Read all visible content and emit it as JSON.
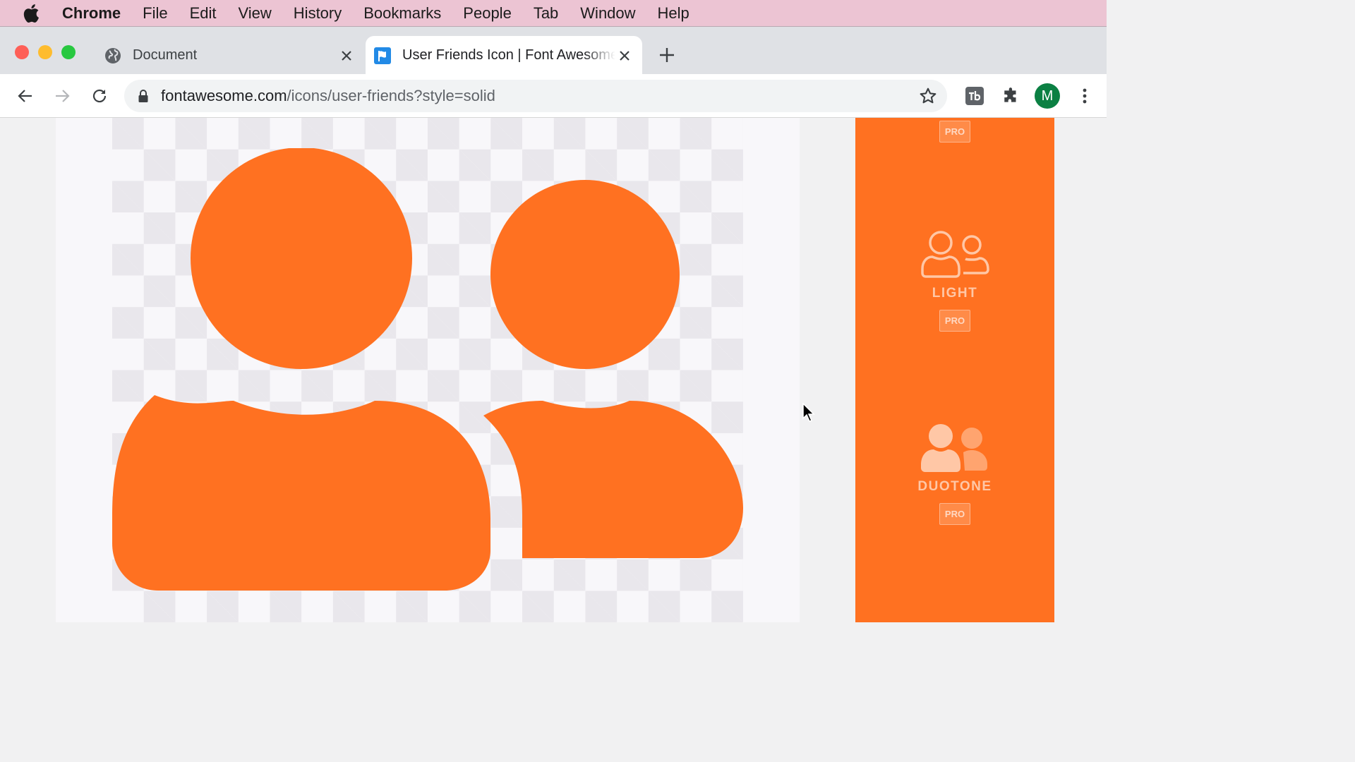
{
  "menubar": {
    "app": "Chrome",
    "items": [
      "File",
      "Edit",
      "View",
      "History",
      "Bookmarks",
      "People",
      "Tab",
      "Window",
      "Help"
    ]
  },
  "tabs": [
    {
      "title": "Document",
      "icon": "globe-icon",
      "active": false
    },
    {
      "title": "User Friends Icon | Font Awesome",
      "icon": "fontawesome-flag-icon",
      "active": true
    }
  ],
  "address": {
    "host": "fontawesome.com",
    "path": "/icons/user-friends?style=solid"
  },
  "profile": {
    "initial": "M",
    "color": "#0b8043"
  },
  "preview": {
    "icon": "user-friends-icon",
    "color": "#ff7121"
  },
  "styles": [
    {
      "label": "",
      "badge": "PRO"
    },
    {
      "label": "LIGHT",
      "badge": "PRO",
      "icon": "user-friends-light-icon"
    },
    {
      "label": "DUOTONE",
      "badge": "PRO",
      "icon": "user-friends-duotone-icon"
    }
  ],
  "colors": {
    "accent": "#ff7121",
    "menubar": "#ecc4d3"
  }
}
